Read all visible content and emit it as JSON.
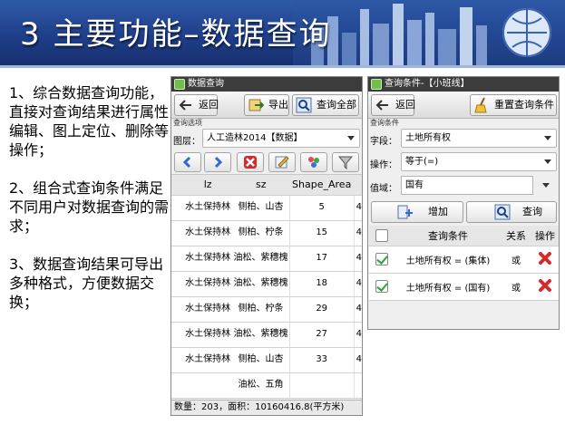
{
  "slide": {
    "title": "3 主要功能–数据查询",
    "notes": [
      "1、综合数据查询功能，直接对查询结果进行属性编辑、图上定位、删除等操作；",
      "2、组合式查询条件满足不同用户对数据查询的需求；",
      "3、数据查询结果可导出多种格式，方便数据交换；"
    ]
  },
  "query_panel": {
    "window_title": "数据查询",
    "back_label": "返回",
    "export_label": "导出",
    "query_all_label": "查询全部",
    "section_label": "查询选项",
    "layer_label": "图层：",
    "layer_value": "人工造林2014【数据】",
    "toolbar_icons": [
      "back-arrow-icon",
      "forward-arrow-icon",
      "delete-icon",
      "edit-icon",
      "layers-icon",
      "filter-icon"
    ],
    "columns": [
      "lz",
      "sz",
      "Shape_Area"
    ],
    "rows": [
      {
        "lz": "水土保持林",
        "sz": "侧柏、山杏",
        "area": "5",
        "extra": "4"
      },
      {
        "lz": "水土保持林",
        "sz": "侧柏、柠条",
        "area": "15",
        "extra": "4"
      },
      {
        "lz": "水土保持林",
        "sz": "油松、紫穗槐",
        "area": "17",
        "extra": "4"
      },
      {
        "lz": "水土保持林",
        "sz": "油松、紫穗槐",
        "area": "18",
        "extra": "4"
      },
      {
        "lz": "水土保持林",
        "sz": "侧柏、柠条",
        "area": "29",
        "extra": "4"
      },
      {
        "lz": "水土保持林",
        "sz": "油松、紫穗槐",
        "area": "27",
        "extra": "4"
      },
      {
        "lz": "水土保持林",
        "sz": "侧柏、山杏",
        "area": "33",
        "extra": "4"
      },
      {
        "lz": "",
        "sz": "油松、五角",
        "area": "",
        "extra": ""
      }
    ],
    "status": "数量：203，面积：10160416.8(平方米)"
  },
  "condition_panel": {
    "window_title": "查询条件-【小班线】",
    "back_label": "返回",
    "reset_label": "重置查询条件",
    "section_label": "查询条件",
    "field_label": "字段：",
    "field_value": "土地所有权",
    "op_label": "操作：",
    "op_value": "等于(=)",
    "value_label": "值域：",
    "value_value": "国有",
    "add_label": "增加",
    "query_label": "查询",
    "columns": [
      "查询条件",
      "关系",
      "操作"
    ],
    "conditions": [
      {
        "text": "土地所有权 = (集体)",
        "relation": "或"
      },
      {
        "text": "土地所有权 = (国有)",
        "relation": "或"
      }
    ]
  },
  "colors": {
    "banner": "#1f3f8a",
    "check": "#2aa13a",
    "delete": "#d42a2a"
  }
}
